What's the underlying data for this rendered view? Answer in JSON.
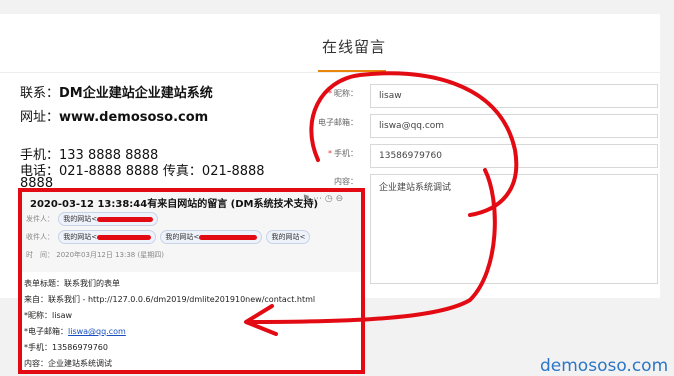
{
  "header": {
    "title": "在线留言"
  },
  "contact_info": {
    "contact_label": "联系：",
    "contact_value": "DM企业建站企业建站系统",
    "website_label": "网址：",
    "website_value": "www.demososo.com",
    "mobile_line": "手机：133 8888 8888",
    "phone_line": "电话：021-8888 8888 传真：021-8888",
    "phone_overflow": "8888"
  },
  "form": {
    "nickname_label": "昵称：",
    "nickname_value": "lisaw",
    "email_label": "电子邮箱：",
    "email_value": "liswa@qq.com",
    "mobile_label": "手机：",
    "mobile_value": "13586979760",
    "content_label": "内容：",
    "content_value": "企业建站系统调试"
  },
  "email": {
    "subject": "2020-03-12 13:38:44有来自网站的留言 (DM系统技术支持)",
    "from_label": "发件人：",
    "from_chip": "我的网站<",
    "to_label": "收件人：",
    "to_chip_1": "我的网站<",
    "to_chip_2": "我的网站<",
    "to_chip_3": "我的网站<",
    "time_label": "时　间：",
    "time_value": "2020年03月12日 13:38 (星期四)",
    "body_form_title": "表单标题：联系我们的表单",
    "body_source": "来自：联系我们 - http://127.0.0.6/dm2019/dmlite201910new/contact.html",
    "body_nickname": "*昵称：lisaw",
    "body_email_label": "*电子邮箱：",
    "body_email_value": "liswa@qq.com",
    "body_mobile": "*手机：13586979760",
    "body_content": "内容：企业建站系统调试"
  },
  "watermark": "demososo.com",
  "colors": {
    "annotation_red": "#e30b13",
    "accent_orange": "#e8860c",
    "link_blue": "#1a4fc0",
    "watermark_blue": "#2b76c6"
  },
  "icons": {
    "required_marker": "asterisk",
    "email_toolbar": [
      "flag-icon",
      "more-icon",
      "clock-icon",
      "delete-icon"
    ]
  }
}
